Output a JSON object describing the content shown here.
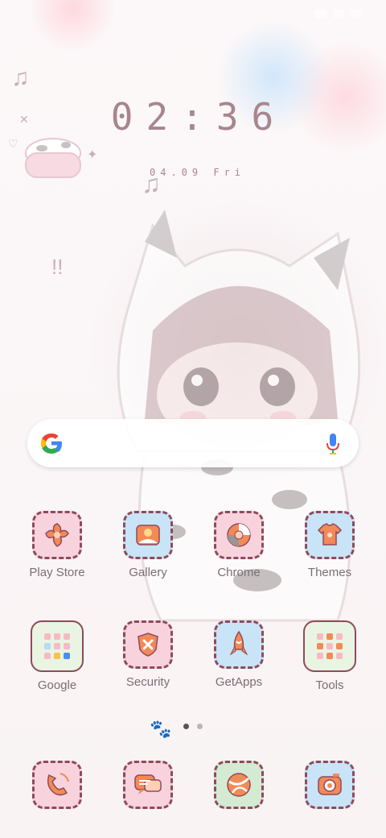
{
  "clock": {
    "time": "02:36",
    "date": "04.09 Fri"
  },
  "search": {
    "logo": "G"
  },
  "apps_row1": [
    {
      "label": "Play Store",
      "icon": "flower-icon",
      "bg": "#f8d3dd"
    },
    {
      "label": "Gallery",
      "icon": "photo-icon",
      "bg": "#c9e4f6"
    },
    {
      "label": "Chrome",
      "icon": "swirl-icon",
      "bg": "#f8d3dd"
    },
    {
      "label": "Themes",
      "icon": "shirt-icon",
      "bg": "#c9e4f6"
    }
  ],
  "apps_row2": [
    {
      "label": "Google",
      "icon": "folder-grid-icon",
      "bg": "#eaf4e3"
    },
    {
      "label": "Security",
      "icon": "shield-icon",
      "bg": "#f8d3dd"
    },
    {
      "label": "GetApps",
      "icon": "rocket-icon",
      "bg": "#c9e4f6"
    },
    {
      "label": "Tools",
      "icon": "folder-grid-icon",
      "bg": "#eaf4e3"
    }
  ],
  "dock": [
    {
      "icon": "phone-icon",
      "bg": "#f8d3dd"
    },
    {
      "icon": "messages-icon",
      "bg": "#f8d3dd"
    },
    {
      "icon": "browser-icon",
      "bg": "#d5ead3"
    },
    {
      "icon": "camera-icon",
      "bg": "#c9e4f6"
    }
  ],
  "page_indicator": {
    "count": 2,
    "active": 1
  },
  "colors": {
    "accent": "#8f4a5c",
    "icon_orange": "#f28a57",
    "text": "#7c6f73"
  }
}
